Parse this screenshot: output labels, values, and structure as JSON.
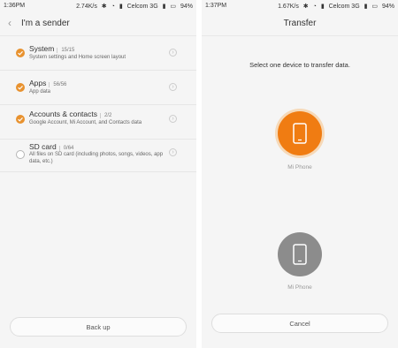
{
  "left": {
    "status": {
      "time": "1:36PM",
      "speed": "2.74K/s",
      "carrier": "Celcom 3G",
      "battery": "94%"
    },
    "title": "I'm a sender",
    "items": [
      {
        "title": "System",
        "count": "15/15",
        "sub": "System settings and Home screen layout",
        "checked": true
      },
      {
        "title": "Apps",
        "count": "56/56",
        "sub": "App data",
        "checked": true
      },
      {
        "title": "Accounts & contacts",
        "count": "2/2",
        "sub": "Google Account, Mi Account, and Contacts data",
        "checked": true
      },
      {
        "title": "SD card",
        "count": "0/64",
        "sub": "All files on SD card (including photos, songs, videos, app data, etc.)",
        "checked": false
      }
    ],
    "button": "Back up"
  },
  "right": {
    "status": {
      "time": "1:37PM",
      "speed": "1.67K/s",
      "carrier": "Celcom 3G",
      "battery": "94%"
    },
    "title": "Transfer",
    "instruction": "Select one device to transfer data.",
    "devices": [
      {
        "label": "Mi Phone",
        "color": "#f07c12"
      },
      {
        "label": "Mi Phone",
        "color": "#8c8c8c"
      }
    ],
    "button": "Cancel"
  },
  "colors": {
    "accent": "#e8922f",
    "device_active": "#f07c12",
    "device_inactive": "#8c8c8c"
  },
  "icons": [
    "back-arrow-icon",
    "bluetooth-icon",
    "wifi-icon",
    "signal-icon",
    "battery-icon",
    "check-icon",
    "chevron-right-icon",
    "phone-icon"
  ]
}
